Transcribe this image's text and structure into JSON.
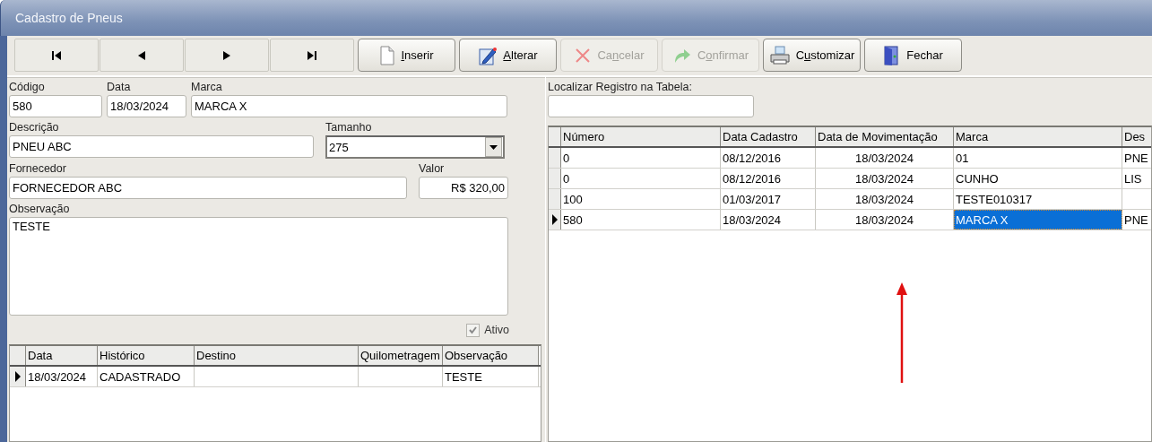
{
  "window": {
    "title": "Cadastro de Pneus"
  },
  "toolbar": [
    {
      "kind": "first"
    },
    {
      "kind": "prev"
    },
    {
      "kind": "next"
    },
    {
      "kind": "last"
    },
    {
      "kind": "insert",
      "label": [
        {
          "text": "I",
          "underlined": true
        },
        {
          "text": "nserir",
          "underlined": false
        }
      ],
      "disabled": false
    },
    {
      "kind": "edit",
      "label": [
        {
          "text": "A",
          "underlined": true
        },
        {
          "text": "lterar",
          "underlined": false
        }
      ],
      "disabled": false
    },
    {
      "kind": "cancel",
      "label": [
        {
          "text": "Ca",
          "underlined": false
        },
        {
          "text": "n",
          "underlined": true
        },
        {
          "text": "celar",
          "underlined": false
        }
      ],
      "disabled": true
    },
    {
      "kind": "confirm",
      "label": [
        {
          "text": "C",
          "underlined": false
        },
        {
          "text": "o",
          "underlined": true
        },
        {
          "text": "nfirmar",
          "underlined": false
        }
      ],
      "disabled": true
    },
    {
      "kind": "print",
      "label": [
        {
          "text": "C",
          "underlined": false
        },
        {
          "text": "u",
          "underlined": true
        },
        {
          "text": "stomizar",
          "underlined": false
        }
      ],
      "disabled": false
    },
    {
      "kind": "exit",
      "label": [
        {
          "text": "Fechar",
          "underlined": false
        }
      ],
      "disabled": false
    }
  ],
  "form": {
    "codigo": {
      "label": "Código",
      "value": "580"
    },
    "data": {
      "label": "Data",
      "value": "18/03/2024"
    },
    "marca": {
      "label": "Marca",
      "value": "MARCA X"
    },
    "descricao": {
      "label": "Descrição",
      "value": "PNEU ABC"
    },
    "tamanho": {
      "label": "Tamanho",
      "value": "275"
    },
    "fornecedor": {
      "label": "Fornecedor",
      "value": "FORNECEDOR ABC"
    },
    "valor": {
      "label": "Valor",
      "value": "R$ 320,00"
    },
    "observacao": {
      "label": "Observação",
      "value": "TESTE"
    },
    "ativo": {
      "label": "Ativo",
      "checked": true,
      "disabled": true
    }
  },
  "history": {
    "columns": [
      {
        "label": "Data"
      },
      {
        "label": "Histórico"
      },
      {
        "label": "Destino"
      },
      {
        "label": "Quilometragem"
      },
      {
        "label": "Observação"
      }
    ],
    "rows": [
      {
        "selected": true,
        "cells": [
          "18/03/2024",
          "CADASTRADO",
          "",
          "",
          "TESTE"
        ]
      }
    ]
  },
  "search": {
    "label": "Localizar Registro na Tabela:"
  },
  "table": {
    "columns": [
      {
        "label": "Número"
      },
      {
        "label": "Data Cadastro"
      },
      {
        "label": "Data de Movimentação"
      },
      {
        "label": "Marca"
      },
      {
        "label": "Des"
      }
    ],
    "rows": [
      {
        "selected": false,
        "cells": [
          {
            "text": "0",
            "selected": false
          },
          {
            "text": "08/12/2016",
            "selected": false
          },
          {
            "text": "18/03/2024",
            "selected": false
          },
          {
            "text": "01",
            "selected": false
          },
          {
            "text": "PNE",
            "selected": false
          }
        ]
      },
      {
        "selected": false,
        "cells": [
          {
            "text": "0",
            "selected": false
          },
          {
            "text": "08/12/2016",
            "selected": false
          },
          {
            "text": "18/03/2024",
            "selected": false
          },
          {
            "text": "CUNHO",
            "selected": false
          },
          {
            "text": "LIS",
            "selected": false
          }
        ]
      },
      {
        "selected": false,
        "cells": [
          {
            "text": "100",
            "selected": false
          },
          {
            "text": "01/03/2017",
            "selected": false
          },
          {
            "text": "18/03/2024",
            "selected": false
          },
          {
            "text": "TESTE010317",
            "selected": false
          },
          {
            "text": "",
            "selected": false
          }
        ]
      },
      {
        "selected": true,
        "cells": [
          {
            "text": "580",
            "selected": false
          },
          {
            "text": "18/03/2024",
            "selected": false
          },
          {
            "text": "18/03/2024",
            "selected": false
          },
          {
            "text": "MARCA X",
            "selected": true
          },
          {
            "text": "PNE",
            "selected": false
          }
        ]
      }
    ]
  }
}
